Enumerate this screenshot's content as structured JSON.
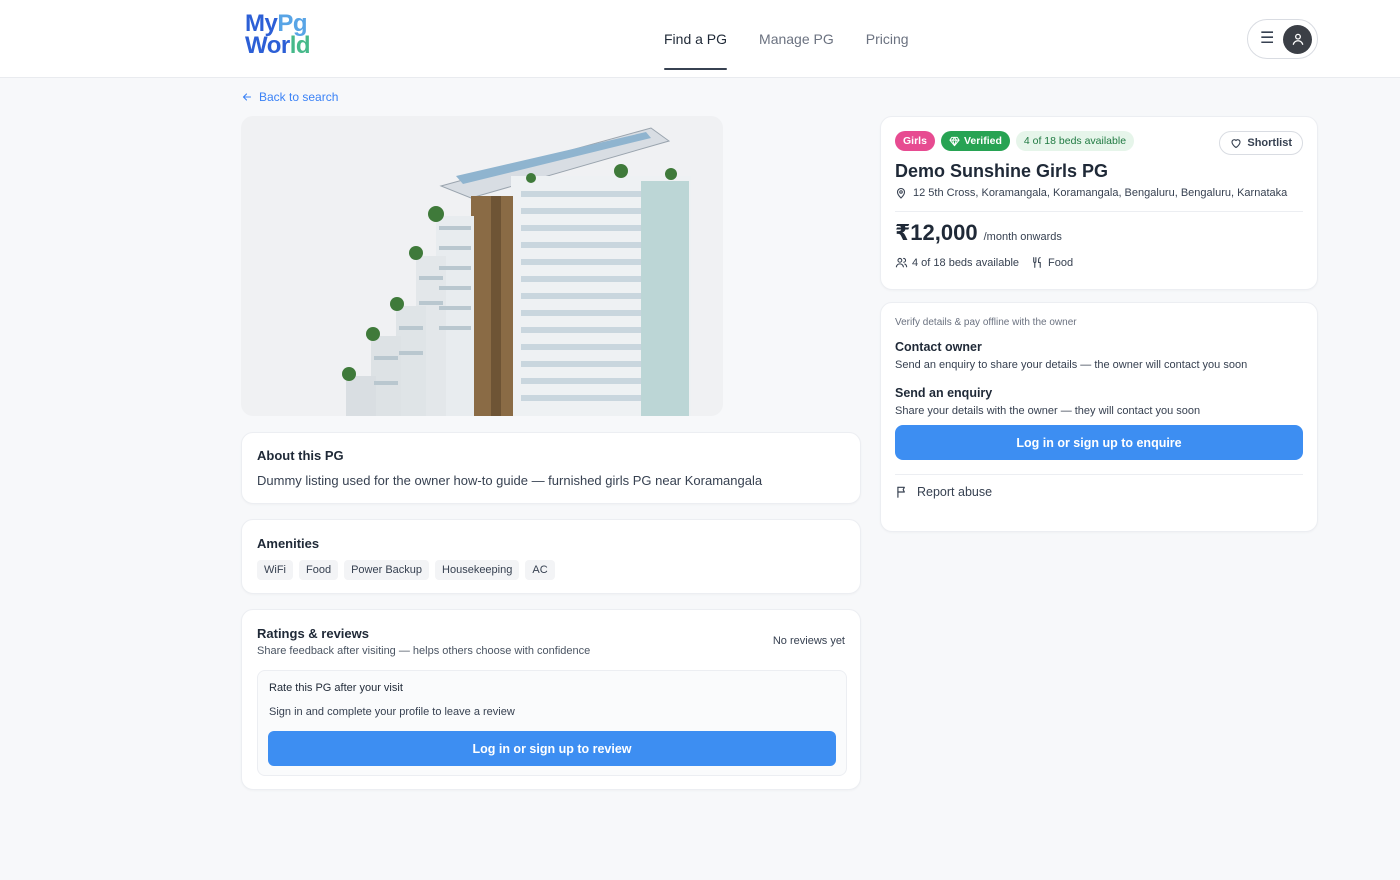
{
  "brand": {
    "line1_a": "My",
    "line1_b": "Pg",
    "line2_a": "Wor",
    "line2_b": "ld"
  },
  "nav": [
    {
      "label": "Find a PG",
      "active": true
    },
    {
      "label": "Manage PG",
      "active": false
    },
    {
      "label": "Pricing",
      "active": false
    }
  ],
  "user_menu": {
    "menu_icon": "hamburger-icon",
    "avatar_icon": "user-icon"
  },
  "back_link": {
    "label": "Back to search",
    "icon": "arrow-left-icon"
  },
  "hero_image": {
    "description_icon": "building-image"
  },
  "about": {
    "title": "About this PG",
    "description": "Dummy listing used for the owner how-to guide — furnished girls PG near Koramangala"
  },
  "amenities": {
    "title": "Amenities",
    "items": [
      "WiFi",
      "Food",
      "Power Backup",
      "Housekeeping",
      "AC"
    ]
  },
  "reviews": {
    "title": "Ratings & reviews",
    "subtitle": "Share feedback after visiting — helps others choose with confidence",
    "status": "No reviews yet",
    "rate_title": "Rate this PG after your visit",
    "rate_hint": "Sign in and complete your profile to leave a review",
    "rate_button": "Log in or sign up to review"
  },
  "listing": {
    "badge_gender": "Girls",
    "badge_verified": "Verified",
    "badge_beds": "4 of 18 beds available",
    "shortlist_label": "Shortlist",
    "name": "Demo Sunshine Girls PG",
    "address": "12 5th Cross, Koramangala, Koramangala, Bengaluru, Bengaluru, Karnataka",
    "price": "₹12,000",
    "price_suffix": "/month onwards",
    "beds_meta": "4 of 18 beds available",
    "food_meta": "Food",
    "colors": {
      "girls": "#e74b91",
      "verified": "#27a353",
      "beds_bg": "#e6f5ea",
      "primary": "#3d8ef2"
    }
  },
  "contact": {
    "hint": "Verify details & pay offline with the owner",
    "contact_title": "Contact owner",
    "contact_text": "Send an enquiry to share your details — the owner will contact you soon",
    "enquiry_title": "Send an enquiry",
    "enquiry_text": "Share your details with the owner — they will contact you soon",
    "enquire_button": "Log in or sign up to enquire",
    "report_label": "Report abuse"
  }
}
